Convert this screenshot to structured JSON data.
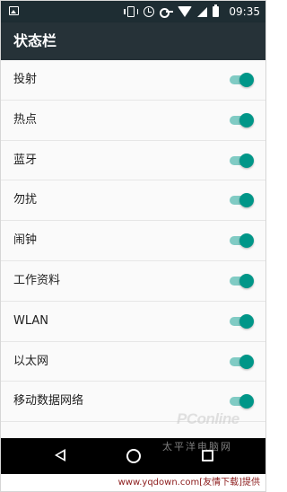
{
  "status_bar": {
    "time": "09:35",
    "icons": [
      "image-icon",
      "vibrate-icon",
      "alarm-icon",
      "key-icon",
      "wifi-icon",
      "signal-icon",
      "battery-icon"
    ]
  },
  "app_bar": {
    "title": "状态栏"
  },
  "settings": [
    {
      "label": "投射",
      "enabled": true
    },
    {
      "label": "热点",
      "enabled": true
    },
    {
      "label": "蓝牙",
      "enabled": true
    },
    {
      "label": "勿扰",
      "enabled": true
    },
    {
      "label": "闹钟",
      "enabled": true
    },
    {
      "label": "工作资料",
      "enabled": true
    },
    {
      "label": "WLAN",
      "enabled": true
    },
    {
      "label": "以太网",
      "enabled": true
    },
    {
      "label": "移动数据网络",
      "enabled": true
    }
  ],
  "nav_bar": {
    "icons": [
      "back-icon",
      "home-icon",
      "recents-icon"
    ]
  },
  "watermark": {
    "logo": "PConline",
    "sub": "太平洋电脑网"
  },
  "footer": {
    "text": "www.yqdown.com[友情下载]提供"
  },
  "colors": {
    "app_bar": "#263238",
    "status_bar": "#1e2d33",
    "toggle_thumb": "#009688",
    "toggle_track": "#80cbc4",
    "footer_text": "#8b1a1a"
  }
}
